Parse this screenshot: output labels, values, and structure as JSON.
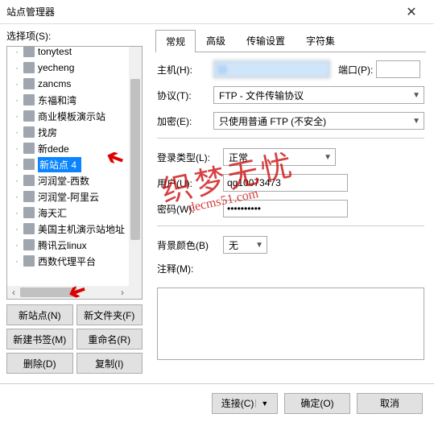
{
  "window": {
    "title": "站点管理器",
    "close": "✕"
  },
  "left": {
    "label": "选择项(S):",
    "items": [
      {
        "label": "tonytest"
      },
      {
        "label": "yecheng"
      },
      {
        "label": "zancms"
      },
      {
        "label": "东福和湾"
      },
      {
        "label": "商业模板演示站"
      },
      {
        "label": "找房"
      },
      {
        "label": "新dede"
      },
      {
        "label": "新站点 4",
        "selected": true
      },
      {
        "label": "河润堂-西数"
      },
      {
        "label": "河润堂-阿里云"
      },
      {
        "label": "海天汇"
      },
      {
        "label": "美国主机演示站地址"
      },
      {
        "label": "腾讯云linux"
      },
      {
        "label": "西数代理平台"
      }
    ],
    "buttons": {
      "new_site": "新站点(N)",
      "new_folder": "新文件夹(F)",
      "new_bookmark": "新建书签(M)",
      "rename": "重命名(R)",
      "delete": "删除(D)",
      "copy": "复制(I)"
    }
  },
  "tabs": {
    "general": "常规",
    "advanced": "高级",
    "transfer": "传输设置",
    "charset": "字符集"
  },
  "form": {
    "host_label": "主机(H):",
    "host_value": "11",
    "port_label": "端口(P):",
    "port_value": "",
    "protocol_label": "协议(T):",
    "protocol_value": "FTP - 文件传输协议",
    "encryption_label": "加密(E):",
    "encryption_value": "只使用普通 FTP (不安全)",
    "logintype_label": "登录类型(L):",
    "logintype_value": "正常",
    "user_label": "用户(U):",
    "user_value": "qq10073473",
    "pass_label": "密码(W):",
    "pass_value": "••••••••••",
    "bg_label": "背景颜色(B)",
    "bg_value": "无",
    "notes_label": "注释(M):",
    "notes_value": ""
  },
  "footer": {
    "connect": "连接(C)",
    "ok": "确定(O)",
    "cancel": "取消"
  },
  "watermark": {
    "big": "织梦无忧",
    "small": "decms51.com"
  }
}
